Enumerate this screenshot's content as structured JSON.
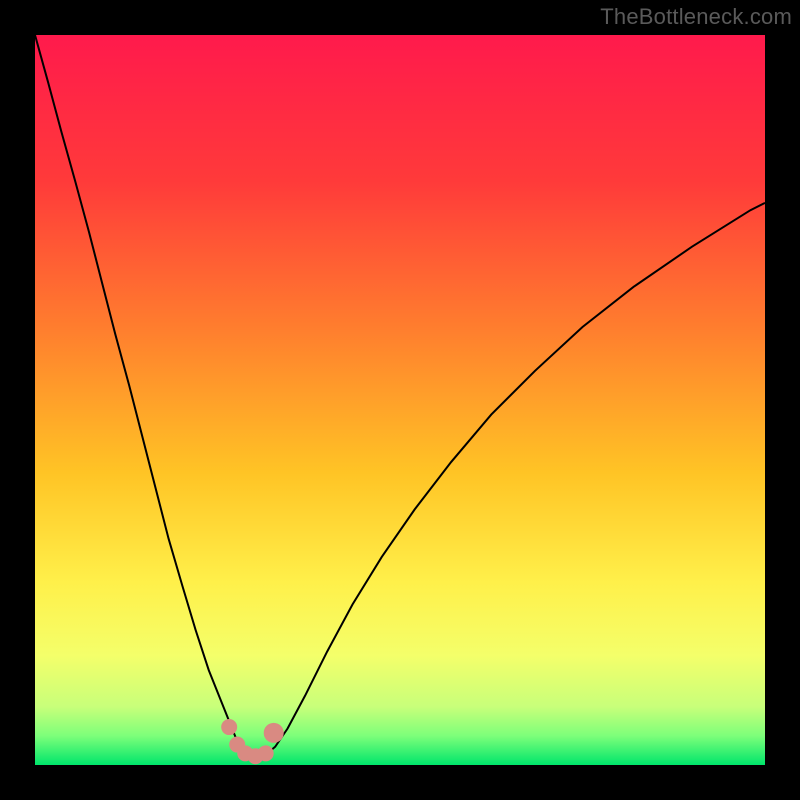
{
  "watermark": "TheBottleneck.com",
  "chart_data": {
    "type": "line",
    "title": "",
    "xlabel": "",
    "ylabel": "",
    "xlim": [
      0,
      100
    ],
    "ylim": [
      0,
      100
    ],
    "background_gradient": {
      "stops": [
        {
          "offset": 0.0,
          "color": "#ff1a4c"
        },
        {
          "offset": 0.2,
          "color": "#ff3a3a"
        },
        {
          "offset": 0.4,
          "color": "#ff7d2e"
        },
        {
          "offset": 0.6,
          "color": "#ffc425"
        },
        {
          "offset": 0.75,
          "color": "#fff04a"
        },
        {
          "offset": 0.85,
          "color": "#f4ff6a"
        },
        {
          "offset": 0.92,
          "color": "#c8ff7a"
        },
        {
          "offset": 0.96,
          "color": "#7dff7a"
        },
        {
          "offset": 1.0,
          "color": "#00e56b"
        }
      ]
    },
    "series": [
      {
        "name": "bottleneck-curve",
        "color": "#000000",
        "stroke_width": 2,
        "x": [
          0.0,
          1.8,
          3.6,
          5.5,
          7.4,
          9.2,
          11.0,
          12.9,
          14.7,
          16.5,
          18.3,
          20.2,
          22.0,
          23.8,
          25.6,
          26.8,
          27.6,
          28.4,
          29.3,
          30.4,
          31.5,
          32.9,
          34.6,
          37.0,
          40.0,
          43.5,
          47.5,
          52.0,
          57.0,
          62.5,
          68.5,
          75.0,
          82.0,
          90.0,
          98.0,
          100.0
        ],
        "y": [
          100.0,
          93.5,
          86.8,
          80.0,
          73.0,
          66.0,
          59.0,
          52.0,
          45.0,
          38.0,
          31.0,
          24.5,
          18.5,
          13.0,
          8.5,
          5.5,
          3.5,
          2.0,
          1.3,
          1.0,
          1.3,
          2.5,
          5.0,
          9.5,
          15.5,
          22.0,
          28.5,
          35.0,
          41.5,
          48.0,
          54.0,
          60.0,
          65.5,
          71.0,
          76.0,
          77.0
        ]
      }
    ],
    "markers": [
      {
        "name": "point-a",
        "x": 26.6,
        "y": 5.2,
        "color": "#d98a82",
        "r": 8
      },
      {
        "name": "point-b",
        "x": 27.7,
        "y": 2.8,
        "color": "#d98a82",
        "r": 8
      },
      {
        "name": "point-c",
        "x": 28.8,
        "y": 1.6,
        "color": "#d98a82",
        "r": 8
      },
      {
        "name": "point-d",
        "x": 30.2,
        "y": 1.2,
        "color": "#d98a82",
        "r": 8
      },
      {
        "name": "point-e",
        "x": 31.6,
        "y": 1.6,
        "color": "#d98a82",
        "r": 8
      },
      {
        "name": "point-f",
        "x": 32.7,
        "y": 4.4,
        "color": "#d98a82",
        "r": 10
      }
    ]
  }
}
